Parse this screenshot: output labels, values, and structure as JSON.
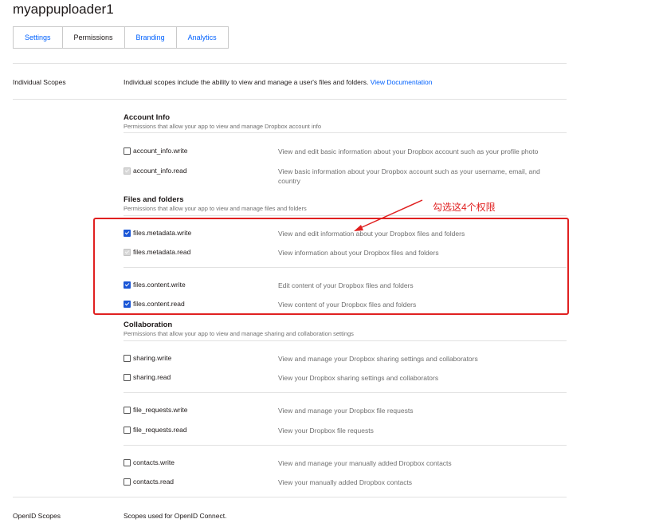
{
  "app": {
    "title": "myappuploader1"
  },
  "tabs": [
    {
      "label": "Settings",
      "active": false
    },
    {
      "label": "Permissions",
      "active": true
    },
    {
      "label": "Branding",
      "active": false
    },
    {
      "label": "Analytics",
      "active": false
    }
  ],
  "individual_scopes": {
    "label": "Individual Scopes",
    "intro_text": "Individual scopes include the ability to view and manage a user's files and folders.",
    "doc_link": "View Documentation"
  },
  "sections": {
    "account_info": {
      "title": "Account Info",
      "subtitle": "Permissions that allow your app to view and manage Dropbox account info",
      "items": [
        {
          "name": "account_info.write",
          "desc": "View and edit basic information about your Dropbox account such as your profile photo",
          "state": "unchecked"
        },
        {
          "name": "account_info.read",
          "desc": "View basic information about your Dropbox account such as your username, email, and country",
          "state": "checked-disabled"
        }
      ]
    },
    "files_and_folders": {
      "title": "Files and folders",
      "subtitle": "Permissions that allow your app to view and manage files and folders",
      "items": [
        {
          "name": "files.metadata.write",
          "desc": "View and edit information about your Dropbox files and folders",
          "state": "checked"
        },
        {
          "name": "files.metadata.read",
          "desc": "View information about your Dropbox files and folders",
          "state": "checked-disabled"
        },
        {
          "name": "files.content.write",
          "desc": "Edit content of your Dropbox files and folders",
          "state": "checked"
        },
        {
          "name": "files.content.read",
          "desc": "View content of your Dropbox files and folders",
          "state": "checked"
        }
      ]
    },
    "collaboration": {
      "title": "Collaboration",
      "subtitle": "Permissions that allow your app to view and manage sharing and collaboration settings",
      "items": [
        {
          "name": "sharing.write",
          "desc": "View and manage your Dropbox sharing settings and collaborators",
          "state": "unchecked"
        },
        {
          "name": "sharing.read",
          "desc": "View your Dropbox sharing settings and collaborators",
          "state": "unchecked"
        },
        {
          "name": "file_requests.write",
          "desc": "View and manage your Dropbox file requests",
          "state": "unchecked"
        },
        {
          "name": "file_requests.read",
          "desc": "View your Dropbox file requests",
          "state": "unchecked"
        },
        {
          "name": "contacts.write",
          "desc": "View and manage your manually added Dropbox contacts",
          "state": "unchecked"
        },
        {
          "name": "contacts.read",
          "desc": "View your manually added Dropbox contacts",
          "state": "unchecked"
        }
      ]
    }
  },
  "openid_scopes": {
    "label": "OpenID Scopes",
    "text": "Scopes used for OpenID Connect."
  },
  "annotation": {
    "text": "勾选这4个权限",
    "color": "#e02020"
  },
  "colors": {
    "link": "#0061fe",
    "checkbox_checked": "#1a56d6",
    "checkbox_disabled": "#d8d8d8",
    "muted_text": "#6f6f6f"
  }
}
